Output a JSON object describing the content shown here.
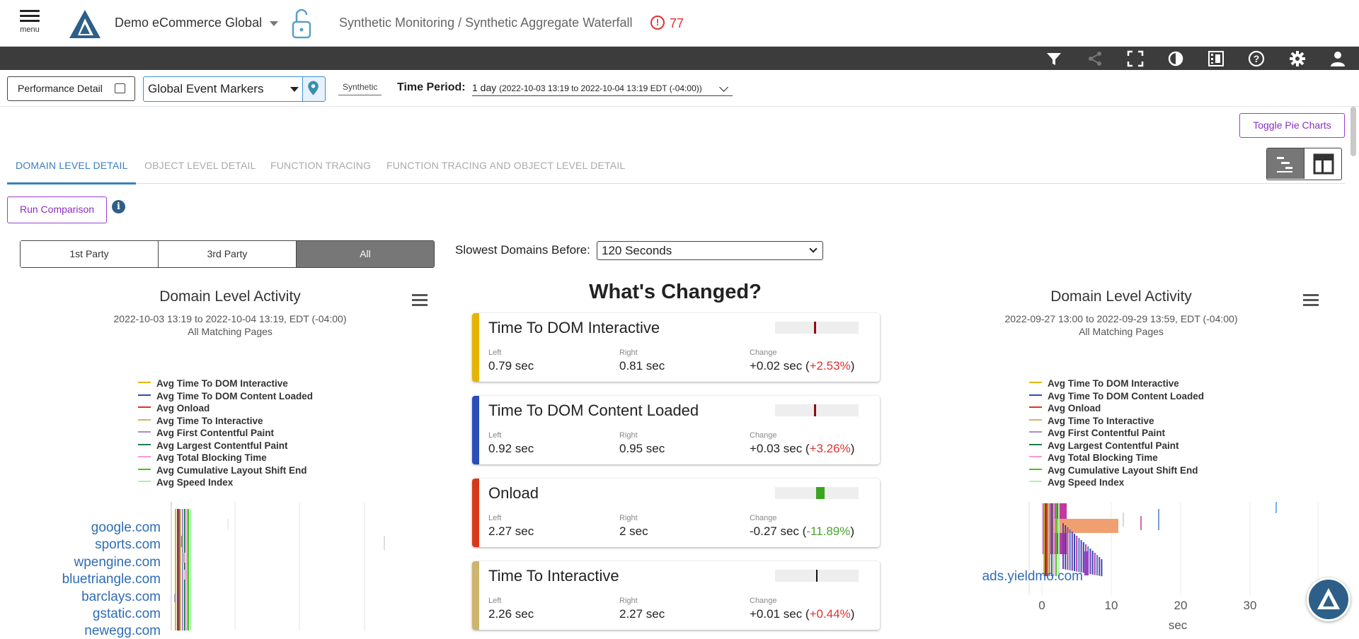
{
  "header": {
    "menu_label": "menu",
    "app_name": "Demo eCommerce Global",
    "breadcrumb": "Synthetic Monitoring / Synthetic Aggregate Waterfall",
    "alert_count": "77"
  },
  "toolbar": {
    "icons": [
      "filter-icon",
      "share-icon",
      "fullscreen-icon",
      "contrast-icon",
      "video-icon",
      "help-icon",
      "settings-icon",
      "user-icon"
    ]
  },
  "filters": {
    "performance_detail": "Performance Detail",
    "event_markers": "Global Event Markers",
    "synthetic": "Synthetic",
    "time_period_label": "Time Period:",
    "time_period_value": "1 day",
    "time_period_range": "(2022-10-03 13:19 to 2022-10-04 13:19 EDT (-04:00))"
  },
  "toggle_pie": "Toggle Pie Charts",
  "tabs": [
    "DOMAIN LEVEL DETAIL",
    "OBJECT LEVEL DETAIL",
    "FUNCTION TRACING",
    "FUNCTION TRACING AND OBJECT LEVEL DETAIL"
  ],
  "run_comparison": "Run Comparison",
  "party": [
    "1st Party",
    "3rd Party",
    "All"
  ],
  "slowest": {
    "label": "Slowest Domains Before:",
    "value": "120 Seconds"
  },
  "legend": [
    {
      "label": "Avg Time To DOM Interactive",
      "color": "#e6b400"
    },
    {
      "label": "Avg Time To DOM Content Loaded",
      "color": "#2a4db8"
    },
    {
      "label": "Avg Onload",
      "color": "#d8381a"
    },
    {
      "label": "Avg Time To Interactive",
      "color": "#cdb56d"
    },
    {
      "label": "Avg First Contentful Paint",
      "color": "#a38ed8"
    },
    {
      "label": "Avg Largest Contentful Paint",
      "color": "#1e7f4b"
    },
    {
      "label": "Avg Total Blocking Time",
      "color": "#f59ad9"
    },
    {
      "label": "Avg Cumulative Layout Shift End",
      "color": "#47c21a"
    },
    {
      "label": "Avg Speed Index",
      "color": "#a4f5b0"
    }
  ],
  "left_chart": {
    "title": "Domain Level Activity",
    "date_range": "2022-10-03 13:19 to 2022-10-04 13:19, EDT (-04:00)",
    "pages": "All Matching Pages",
    "domains": [
      "google.com",
      "sports.com",
      "wpengine.com",
      "bluetriangle.com",
      "barclays.com",
      "gstatic.com",
      "newegg.com"
    ]
  },
  "right_chart": {
    "title": "Domain Level Activity",
    "date_range": "2022-09-27 13:00 to 2022-09-29 13:59, EDT (-04:00)",
    "pages": "All Matching Pages",
    "domains": [
      "ads.yieldmo.com"
    ],
    "x_ticks": [
      "0",
      "10",
      "20",
      "30"
    ],
    "x_label": "sec"
  },
  "whats_changed": {
    "title": "What's Changed?",
    "col_left": "Left",
    "col_right": "Right",
    "col_change": "Change",
    "metrics": [
      {
        "name": "Time To DOM Interactive",
        "color": "#e6b400",
        "left": "0.79 sec",
        "right": "0.81 sec",
        "change": "+0.02 sec (",
        "pct": "+2.53%",
        "close": ")",
        "dir": "up"
      },
      {
        "name": "Time To DOM Content Loaded",
        "color": "#2a4db8",
        "left": "0.92 sec",
        "right": "0.95 sec",
        "change": "+0.03 sec (",
        "pct": "+3.26%",
        "close": ")",
        "dir": "up"
      },
      {
        "name": "Onload",
        "color": "#d8381a",
        "left": "2.27 sec",
        "right": "2 sec",
        "change": "-0.27 sec (",
        "pct": "-11.89%",
        "close": ")",
        "dir": "down"
      },
      {
        "name": "Time To Interactive",
        "color": "#cdb56d",
        "left": "2.26 sec",
        "right": "2.27 sec",
        "change": "+0.01 sec (",
        "pct": "+0.44%",
        "close": ")",
        "dir": "up"
      }
    ]
  }
}
